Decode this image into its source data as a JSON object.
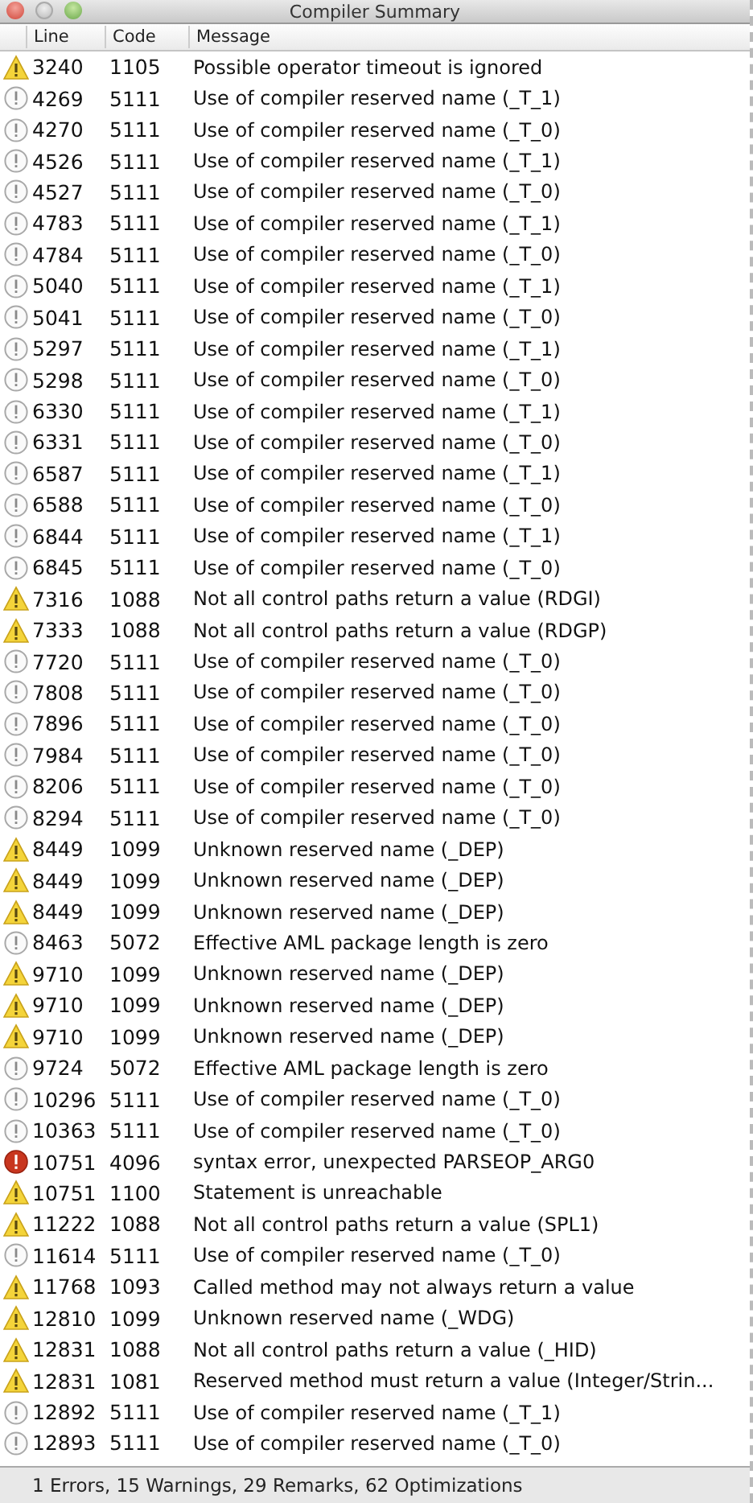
{
  "window": {
    "title": "Compiler Summary"
  },
  "table": {
    "columns": [
      "Line",
      "Code",
      "Message"
    ],
    "rows": [
      {
        "kind": "warning",
        "line": "3240",
        "code": "1105",
        "message": "Possible operator timeout is ignored"
      },
      {
        "kind": "remark",
        "line": "4269",
        "code": "5111",
        "message": "Use of compiler reserved name (_T_1)"
      },
      {
        "kind": "remark",
        "line": "4270",
        "code": "5111",
        "message": "Use of compiler reserved name (_T_0)"
      },
      {
        "kind": "remark",
        "line": "4526",
        "code": "5111",
        "message": "Use of compiler reserved name (_T_1)"
      },
      {
        "kind": "remark",
        "line": "4527",
        "code": "5111",
        "message": "Use of compiler reserved name (_T_0)"
      },
      {
        "kind": "remark",
        "line": "4783",
        "code": "5111",
        "message": "Use of compiler reserved name (_T_1)"
      },
      {
        "kind": "remark",
        "line": "4784",
        "code": "5111",
        "message": "Use of compiler reserved name (_T_0)"
      },
      {
        "kind": "remark",
        "line": "5040",
        "code": "5111",
        "message": "Use of compiler reserved name (_T_1)"
      },
      {
        "kind": "remark",
        "line": "5041",
        "code": "5111",
        "message": "Use of compiler reserved name (_T_0)"
      },
      {
        "kind": "remark",
        "line": "5297",
        "code": "5111",
        "message": "Use of compiler reserved name (_T_1)"
      },
      {
        "kind": "remark",
        "line": "5298",
        "code": "5111",
        "message": "Use of compiler reserved name (_T_0)"
      },
      {
        "kind": "remark",
        "line": "6330",
        "code": "5111",
        "message": "Use of compiler reserved name (_T_1)"
      },
      {
        "kind": "remark",
        "line": "6331",
        "code": "5111",
        "message": "Use of compiler reserved name (_T_0)"
      },
      {
        "kind": "remark",
        "line": "6587",
        "code": "5111",
        "message": "Use of compiler reserved name (_T_1)"
      },
      {
        "kind": "remark",
        "line": "6588",
        "code": "5111",
        "message": "Use of compiler reserved name (_T_0)"
      },
      {
        "kind": "remark",
        "line": "6844",
        "code": "5111",
        "message": "Use of compiler reserved name (_T_1)"
      },
      {
        "kind": "remark",
        "line": "6845",
        "code": "5111",
        "message": "Use of compiler reserved name (_T_0)"
      },
      {
        "kind": "warning",
        "line": "7316",
        "code": "1088",
        "message": "Not all control paths return a value (RDGI)"
      },
      {
        "kind": "warning",
        "line": "7333",
        "code": "1088",
        "message": "Not all control paths return a value (RDGP)"
      },
      {
        "kind": "remark",
        "line": "7720",
        "code": "5111",
        "message": "Use of compiler reserved name (_T_0)"
      },
      {
        "kind": "remark",
        "line": "7808",
        "code": "5111",
        "message": "Use of compiler reserved name (_T_0)"
      },
      {
        "kind": "remark",
        "line": "7896",
        "code": "5111",
        "message": "Use of compiler reserved name (_T_0)"
      },
      {
        "kind": "remark",
        "line": "7984",
        "code": "5111",
        "message": "Use of compiler reserved name (_T_0)"
      },
      {
        "kind": "remark",
        "line": "8206",
        "code": "5111",
        "message": "Use of compiler reserved name (_T_0)"
      },
      {
        "kind": "remark",
        "line": "8294",
        "code": "5111",
        "message": "Use of compiler reserved name (_T_0)"
      },
      {
        "kind": "warning",
        "line": "8449",
        "code": "1099",
        "message": "Unknown reserved name (_DEP)"
      },
      {
        "kind": "warning",
        "line": "8449",
        "code": "1099",
        "message": "Unknown reserved name (_DEP)"
      },
      {
        "kind": "warning",
        "line": "8449",
        "code": "1099",
        "message": "Unknown reserved name (_DEP)"
      },
      {
        "kind": "remark",
        "line": "8463",
        "code": "5072",
        "message": "Effective AML package length is zero"
      },
      {
        "kind": "warning",
        "line": "9710",
        "code": "1099",
        "message": "Unknown reserved name (_DEP)"
      },
      {
        "kind": "warning",
        "line": "9710",
        "code": "1099",
        "message": "Unknown reserved name (_DEP)"
      },
      {
        "kind": "warning",
        "line": "9710",
        "code": "1099",
        "message": "Unknown reserved name (_DEP)"
      },
      {
        "kind": "remark",
        "line": "9724",
        "code": "5072",
        "message": "Effective AML package length is zero"
      },
      {
        "kind": "remark",
        "line": "10296",
        "code": "5111",
        "message": "Use of compiler reserved name (_T_0)"
      },
      {
        "kind": "remark",
        "line": "10363",
        "code": "5111",
        "message": "Use of compiler reserved name (_T_0)"
      },
      {
        "kind": "error",
        "line": "10751",
        "code": "4096",
        "message": "syntax error, unexpected PARSEOP_ARG0"
      },
      {
        "kind": "warning",
        "line": "10751",
        "code": "1100",
        "message": "Statement is unreachable"
      },
      {
        "kind": "warning",
        "line": "11222",
        "code": "1088",
        "message": "Not all control paths return a value (SPL1)"
      },
      {
        "kind": "remark",
        "line": "11614",
        "code": "5111",
        "message": "Use of compiler reserved name (_T_0)"
      },
      {
        "kind": "warning",
        "line": "11768",
        "code": "1093",
        "message": "Called method may not always return a value"
      },
      {
        "kind": "warning",
        "line": "12810",
        "code": "1099",
        "message": "Unknown reserved name (_WDG)"
      },
      {
        "kind": "warning",
        "line": "12831",
        "code": "1088",
        "message": "Not all control paths return a value (_HID)"
      },
      {
        "kind": "warning",
        "line": "12831",
        "code": "1081",
        "message": "Reserved method must return a value (Integer/Strin..."
      },
      {
        "kind": "remark",
        "line": "12892",
        "code": "5111",
        "message": "Use of compiler reserved name (_T_1)"
      },
      {
        "kind": "remark",
        "line": "12893",
        "code": "5111",
        "message": "Use of compiler reserved name (_T_0)"
      }
    ]
  },
  "status_bar": "1 Errors, 15 Warnings, 29 Remarks, 62 Optimizations"
}
